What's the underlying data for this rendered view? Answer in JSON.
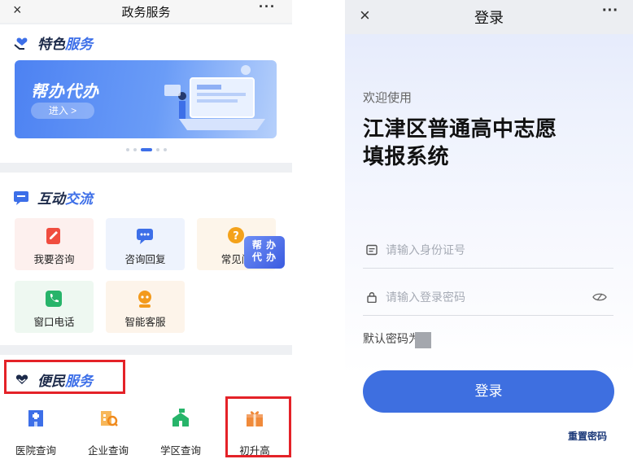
{
  "left_page": {
    "topbar": {
      "close_icon": "×",
      "title": "政务服务",
      "more_icon": "···"
    },
    "featured": {
      "heading_part1": "特色",
      "heading_part2": "服务",
      "banner": {
        "title": "帮办代办",
        "enter_label": "进入 >"
      }
    },
    "interaction": {
      "heading_part1": "互动",
      "heading_part2": "交流",
      "tiles": [
        {
          "label": "我要咨询",
          "icon": "edit-doc-icon",
          "color": "#f04d3f"
        },
        {
          "label": "咨询回复",
          "icon": "chat-icon",
          "color": "#3d6fe8"
        },
        {
          "label": "常见问",
          "icon": "question-icon",
          "color": "#f4a21a"
        },
        {
          "label": "窗口电话",
          "icon": "phone-icon",
          "color": "#27b46a"
        },
        {
          "label": "智能客服",
          "icon": "robot-icon",
          "color": "#f39a1c"
        }
      ],
      "float_label_line1": "帮 办",
      "float_label_line2": "代 办"
    },
    "convenience": {
      "heading_part1": "便民",
      "heading_part2": "服务",
      "services": [
        {
          "label": "医院查询",
          "icon": "hospital-icon",
          "color": "#3d6fe8"
        },
        {
          "label": "企业查询",
          "icon": "company-search-icon",
          "color": "#f39a1c"
        },
        {
          "label": "学区查询",
          "icon": "school-icon",
          "color": "#27b46a"
        },
        {
          "label": "初升高",
          "icon": "gift-box-icon",
          "color": "#f08a3a"
        }
      ]
    }
  },
  "right_page": {
    "topbar": {
      "close_icon": "×",
      "title": "登录",
      "more_icon": "···"
    },
    "welcome": "欢迎使用",
    "system_title_line1": "江津区普通高中志愿",
    "system_title_line2": "填报系统",
    "id_field": {
      "placeholder": "请输入身份证号",
      "value": ""
    },
    "password_field": {
      "placeholder": "请输入登录密码",
      "value": ""
    },
    "default_password_label": "默认密码为",
    "login_button": "登录",
    "reset_password_link": "重置密码"
  },
  "colors": {
    "accent": "#3e6fe0",
    "highlight_red": "#e42228"
  }
}
